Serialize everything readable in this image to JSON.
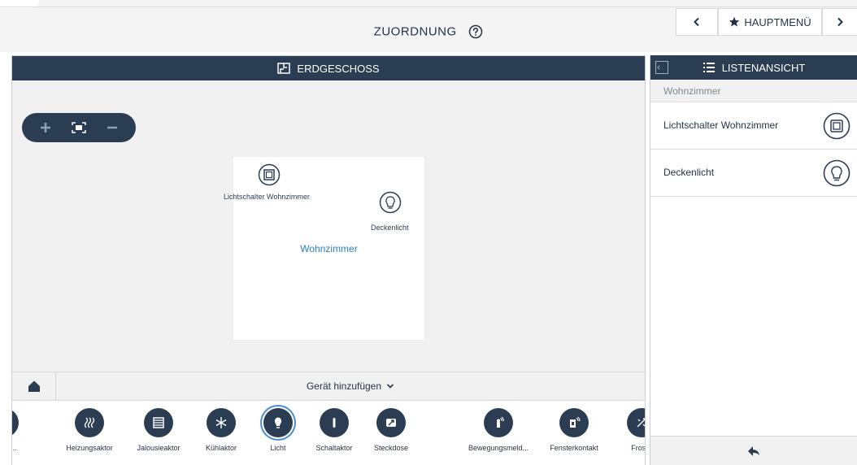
{
  "header": {
    "title": "ZUORDNUNG",
    "home_label": "HAUPTMENÜ"
  },
  "floor": {
    "title": "ERDGESCHOSS",
    "room": {
      "name": "Wohnzimmer",
      "devices": [
        {
          "label": "Lichtschalter Wohnzimmer",
          "icon": "switch-icon"
        },
        {
          "label": "Deckenlicht",
          "icon": "bulb-icon"
        }
      ]
    },
    "add_device_label": "Gerät hinzufügen"
  },
  "device_strip": {
    "items": [
      {
        "label": "eizen ...",
        "icon": "heating-icon"
      },
      {
        "label": "Heizungsaktor",
        "icon": "heating-actuator-icon"
      },
      {
        "label": "Jalousieaktor",
        "icon": "blind-actuator-icon"
      },
      {
        "label": "Kühlaktor",
        "icon": "snowflake-icon"
      },
      {
        "label": "Licht",
        "icon": "bulb-icon",
        "selected": true
      },
      {
        "label": "Schaltaktor",
        "icon": "switch-actuator-icon"
      },
      {
        "label": "Steckdose",
        "icon": "socket-icon"
      },
      {
        "label": "Bewegungsmeld...",
        "icon": "motion-sensor-icon"
      },
      {
        "label": "Fensterkontakt",
        "icon": "window-contact-icon"
      },
      {
        "label": "Frosta",
        "icon": "frost-icon"
      }
    ]
  },
  "list": {
    "title": "LISTENANSICHT",
    "section": "Wohnzimmer",
    "items": [
      {
        "label": "Lichtschalter Wohnzimmer",
        "icon": "switch-icon"
      },
      {
        "label": "Deckenlicht",
        "icon": "bulb-icon"
      }
    ]
  },
  "colors": {
    "primary": "#2b3d52",
    "accent": "#2f80c6",
    "background": "#f1f1f1"
  }
}
